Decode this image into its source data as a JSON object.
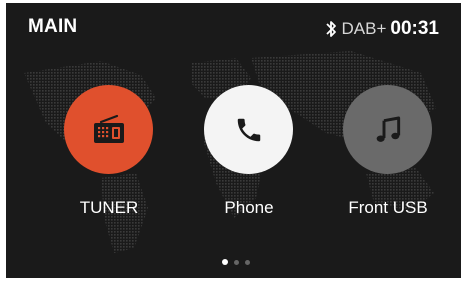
{
  "header": {
    "title": "MAIN",
    "source": "DAB+",
    "time": "00:31",
    "bluetooth_icon": "bluetooth-icon"
  },
  "apps": [
    {
      "label": "TUNER",
      "icon": "radio-icon",
      "color": "#e0502d"
    },
    {
      "label": "Phone",
      "icon": "phone-icon",
      "color": "#f4f4f4"
    },
    {
      "label": "Front USB",
      "icon": "music-note-icon",
      "color": "#6a6a6a"
    }
  ],
  "pager": {
    "pages": 3,
    "current": 1
  }
}
